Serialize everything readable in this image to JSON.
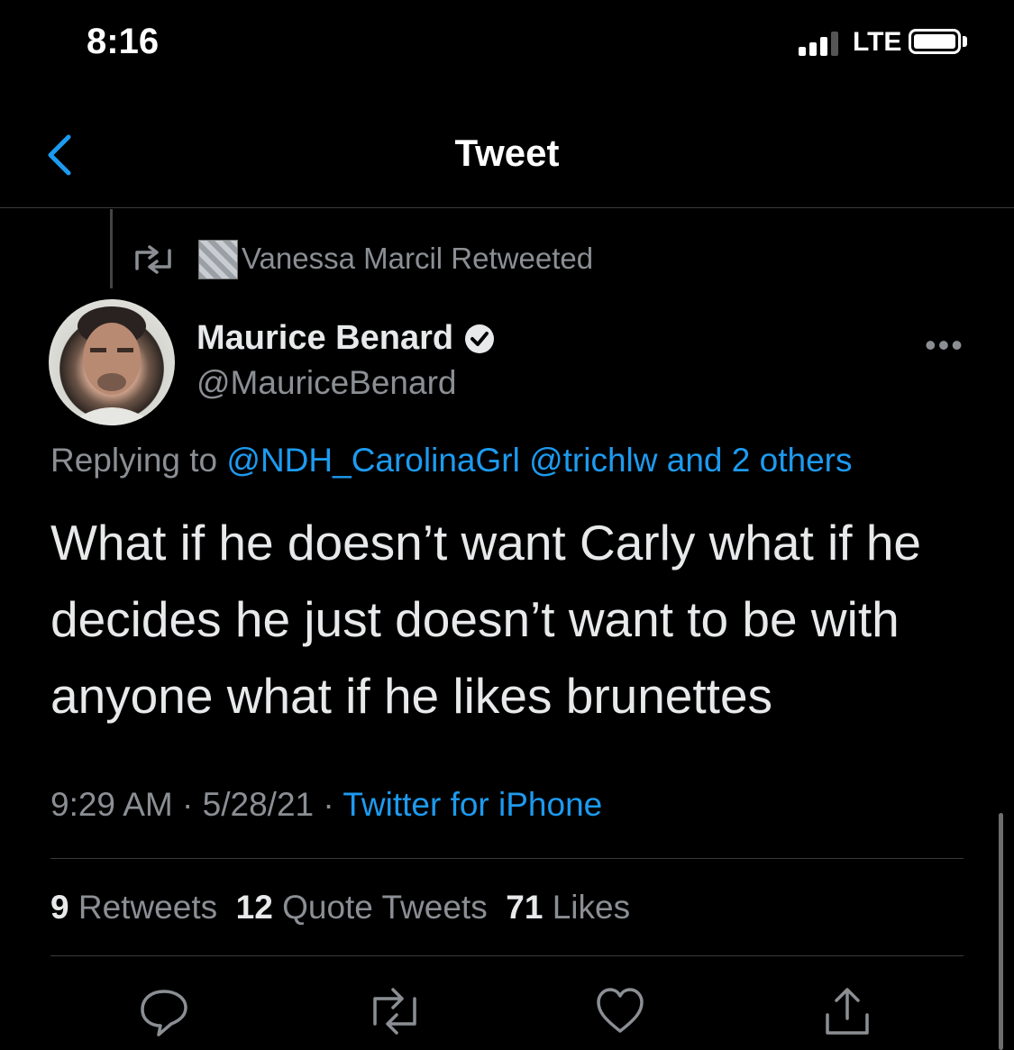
{
  "status_bar": {
    "time": "8:16",
    "network": "LTE"
  },
  "header": {
    "title": "Tweet",
    "back_icon": "chevron-left-icon"
  },
  "retweet_banner": {
    "text": "Vanessa Marcil Retweeted"
  },
  "author": {
    "name": "Maurice Benard",
    "handle": "@MauriceBenard",
    "verified": true
  },
  "replying": {
    "prefix": "Replying to ",
    "mention1": "@NDH_CarolinaGrl",
    "mention2": "@trichlw",
    "suffix": "and 2 others"
  },
  "tweet": {
    "text": "What if he doesn’t want Carly what if he decides he just doesn’t want to be with anyone what if he likes brunettes"
  },
  "meta": {
    "time": "9:29 AM",
    "date": "5/28/21",
    "source": "Twitter for iPhone"
  },
  "stats": {
    "retweets_count": "9",
    "retweets_label": "Retweets",
    "quotes_count": "12",
    "quotes_label": "Quote Tweets",
    "likes_count": "71",
    "likes_label": "Likes"
  },
  "colors": {
    "link": "#1d9bf0",
    "background": "#000000",
    "muted": "#8b8f94"
  }
}
